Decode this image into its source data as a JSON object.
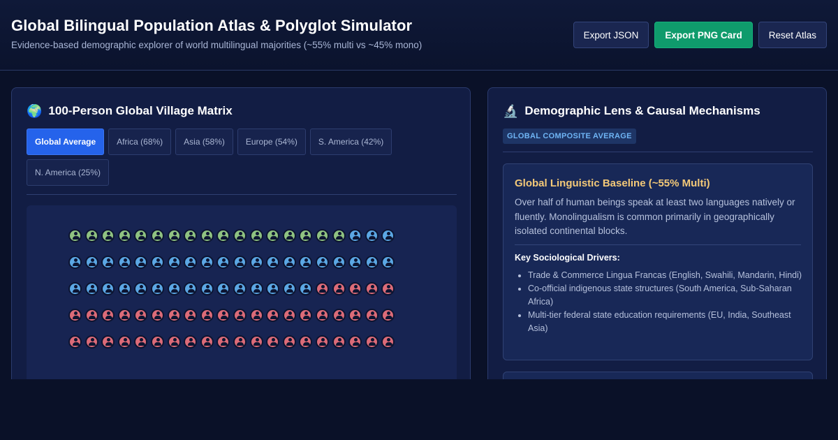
{
  "header": {
    "title": "Global Bilingual Population Atlas & Polyglot Simulator",
    "subtitle": "Evidence-based demographic explorer of world multilingual majorities (~55% multi vs ~45% mono)",
    "buttons": {
      "export_json": "Export JSON",
      "export_png": "Export PNG Card",
      "reset": "Reset Atlas"
    }
  },
  "village": {
    "icon": "globe-emoji",
    "title": "100-Person Global Village Matrix",
    "regions": [
      {
        "label": "Global Average",
        "active": true
      },
      {
        "label": "Africa (68%)",
        "active": false
      },
      {
        "label": "Asia (58%)",
        "active": false
      },
      {
        "label": "Europe (54%)",
        "active": false
      },
      {
        "label": "S. America (42%)",
        "active": false
      },
      {
        "label": "N. America (25%)",
        "active": false
      }
    ],
    "matrix_rows": [
      "gggggggggggggggggbbb",
      "bbbbbbbbbbbbbbbbbbbb",
      "bbbbbbbbbbbbbbbrrrrr",
      "rrrrrrrrrrrrrrrrrrrr",
      "rrrrrrrrrrrrrrrrrrrr"
    ],
    "colors": {
      "g": "#8fc281",
      "b": "#5ba7e4",
      "r": "#dc6b78"
    }
  },
  "lens": {
    "icon": "microscope-emoji",
    "title": "Demographic Lens & Causal Mechanisms",
    "badge": "GLOBAL COMPOSITE AVERAGE",
    "card": {
      "heading": "Global Linguistic Baseline (~55% Multi)",
      "description": "Over half of human beings speak at least two languages natively or fluently. Monolingualism is common primarily in geographically isolated continental blocks.",
      "drivers_label": "Key Sociological Drivers:",
      "drivers": [
        "Trade & Commerce Lingua Francas (English, Swahili, Mandarin, Hindi)",
        "Co-official indigenous state structures (South America, Sub-Saharan Africa)",
        "Multi-tier federal state education requirements (EU, India, Southeast Asia)"
      ]
    }
  }
}
